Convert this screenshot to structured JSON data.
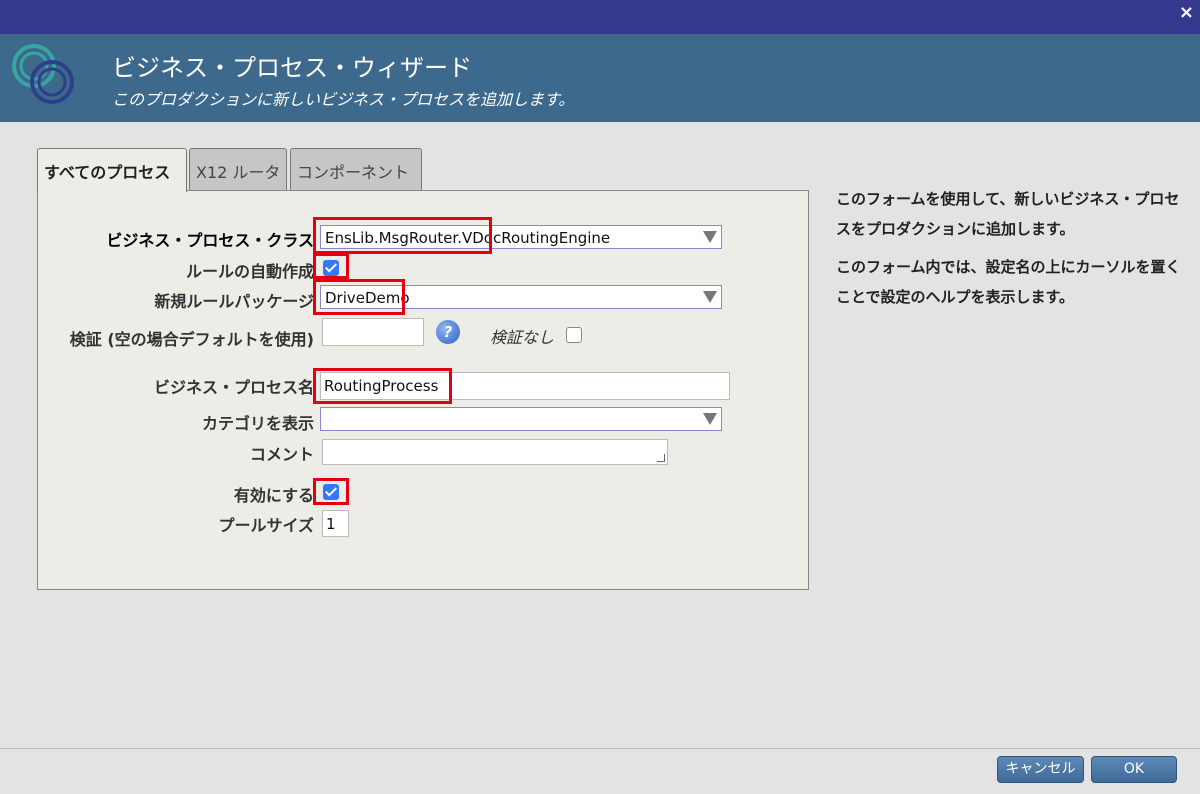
{
  "window": {
    "close_label": "×"
  },
  "header": {
    "title": "ビジネス・プロセス・ウィザード",
    "subtitle": "このプロダクションに新しいビジネス・プロセスを追加します。",
    "logo_icon": "intersystems-logo-icon"
  },
  "tabs": [
    {
      "label": "すべてのプロセス",
      "active": true
    },
    {
      "label": "X12 ルータ",
      "active": false
    },
    {
      "label": "コンポーネント",
      "active": false
    }
  ],
  "form": {
    "bp_class": {
      "label": "ビジネス・プロセス・クラス",
      "value": "EnsLib.MsgRouter.VDocRoutingEngine"
    },
    "auto_rule": {
      "label": "ルールの自動作成",
      "checked": true
    },
    "rule_package": {
      "label": "新規ルールパッケージ",
      "value": "DriveDemo"
    },
    "validation": {
      "label": "検証 (空の場合デフォルトを使用)",
      "value": "",
      "no_validation_label": "検証なし",
      "no_validation_checked": false
    },
    "bp_name": {
      "label": "ビジネス・プロセス名",
      "value": "RoutingProcess"
    },
    "category": {
      "label": "カテゴリを表示",
      "value": ""
    },
    "comment": {
      "label": "コメント",
      "value": ""
    },
    "enabled": {
      "label": "有効にする",
      "checked": true
    },
    "pool_size": {
      "label": "プールサイズ",
      "value": "1"
    }
  },
  "side": {
    "para1": "このフォームを使用して、新しいビジネス・プロセスをプロダクションに追加します。",
    "para2": "このフォーム内では、設定名の上にカーソルを置くことで設定のヘルプを表示します。"
  },
  "buttons": {
    "cancel": "キャンセル",
    "ok": "OK"
  },
  "colors": {
    "topbar": "#363a8f",
    "header": "#3d6a8c",
    "highlight": "#e3000f",
    "checkbox": "#3478f6"
  }
}
